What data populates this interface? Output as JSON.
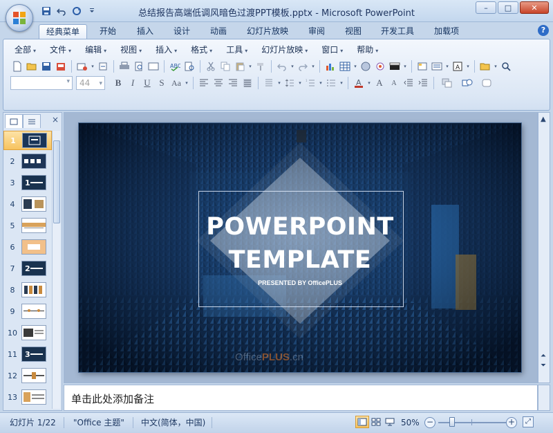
{
  "window": {
    "title": "总结报告高端低调风暗色过渡PPT模板.pptx - Microsoft PowerPoint",
    "minimize": "–",
    "maximize": "□",
    "close": "✕"
  },
  "qat": {
    "save_icon": "save-icon",
    "undo_icon": "undo-icon",
    "redo_icon": "redo-icon",
    "customize_icon": "customize-icon"
  },
  "ribbon": {
    "tabs": [
      "经典菜单",
      "开始",
      "插入",
      "设计",
      "动画",
      "幻灯片放映",
      "审阅",
      "视图",
      "开发工具",
      "加载项"
    ],
    "active_tab": "经典菜单",
    "help": "?"
  },
  "classic_menu": {
    "items": [
      "全部",
      "文件",
      "编辑",
      "视图",
      "插入",
      "格式",
      "工具",
      "幻灯片放映",
      "窗口",
      "帮助"
    ]
  },
  "toolbar": {
    "font_name": "",
    "font_size": "44",
    "bold": "B",
    "italic": "I",
    "underline": "U",
    "shadow": "S",
    "change_case": "Aa",
    "font_color": "A",
    "grow_font": "A",
    "shrink_font": "A"
  },
  "slides_pane": {
    "numbers": [
      "1",
      "2",
      "3",
      "4",
      "5",
      "6",
      "7",
      "8",
      "9",
      "10",
      "11",
      "12",
      "13"
    ],
    "selected": "1",
    "close": "×"
  },
  "slide": {
    "title_line_1": "POWERPOINT",
    "title_line_2": "TEMPLATE",
    "subtitle": "PRESENTED BY OfficePLUS",
    "watermark_prefix": "Office",
    "watermark_plus": "PLUS",
    "watermark_suffix": ".cn"
  },
  "notes": {
    "placeholder": "单击此处添加备注"
  },
  "status": {
    "slide_counter": "幻灯片 1/22",
    "theme": "\"Office 主题\"",
    "language": "中文(简体，中国)",
    "zoom": "50%",
    "zoom_level": 0.5
  },
  "colors": {
    "accent_blue": "#2e6cc7",
    "selection_orange": "#f7c35f",
    "slide_dark": "#0c1a2e"
  }
}
